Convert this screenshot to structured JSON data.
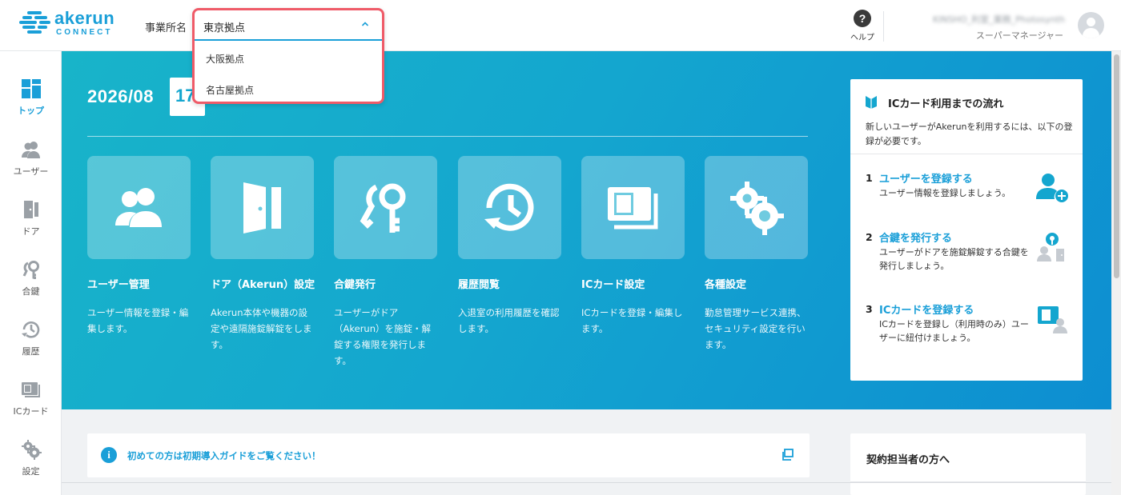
{
  "header": {
    "logo_text": "akerun",
    "logo_sub": "CONNECT",
    "office_label": "事業所名",
    "help_label": "ヘルプ",
    "user_name": "KINSHO_利室_業務_Photosynth",
    "user_role": "スーパーマネージャー"
  },
  "office_dropdown": {
    "selected": "東京拠点",
    "options": [
      "大阪拠点",
      "名古屋拠点"
    ]
  },
  "sidebar": {
    "items": [
      {
        "label": "トップ",
        "icon": "dashboard-icon",
        "active": true
      },
      {
        "label": "ユーザー",
        "icon": "users-icon"
      },
      {
        "label": "ドア",
        "icon": "door-icon"
      },
      {
        "label": "合鍵",
        "icon": "key-icon"
      },
      {
        "label": "履歴",
        "icon": "history-icon"
      },
      {
        "label": "ICカード",
        "icon": "ic-card-icon"
      },
      {
        "label": "設定",
        "icon": "gear-icon"
      }
    ]
  },
  "hero": {
    "date": "2026/08",
    "day": "17",
    "features": [
      {
        "title": "ユーザー管理",
        "desc": "ユーザー情報を登録・編集します。",
        "icon": "users-icon"
      },
      {
        "title": "ドア（Akerun）設定",
        "desc": "Akerun本体や機器の設定や遠隔施錠解錠をします。",
        "icon": "door-icon"
      },
      {
        "title": "合鍵発行",
        "desc": "ユーザーがドア（Akerun）を施錠・解錠する権限を発行します。",
        "icon": "key-icon"
      },
      {
        "title": "履歴閲覧",
        "desc": "入退室の利用履歴を確認します。",
        "icon": "history-icon"
      },
      {
        "title": "ICカード設定",
        "desc": "ICカードを登録・編集します。",
        "icon": "ic-card-icon"
      },
      {
        "title": "各種設定",
        "desc": "勤怠管理サービス連携、セキュリティ設定を行います。",
        "icon": "gear-icon"
      }
    ]
  },
  "flow": {
    "title": "ICカード利用までの流れ",
    "intro": "新しいユーザーがAkerunを利用するには、以下の登録が必要です。",
    "steps": [
      {
        "num": "1",
        "title": "ユーザーを登録する",
        "desc": "ユーザー情報を登録しましょう。",
        "icon": "add-user-icon"
      },
      {
        "num": "2",
        "title": "合鍵を発行する",
        "desc": "ユーザーがドアを施錠解錠する合鍵を発行しましょう。",
        "icon": "key-user-icon"
      },
      {
        "num": "3",
        "title": "ICカードを登録する",
        "desc": "ICカードを登録し（利用時のみ）ユーザーに紐付けましょう。",
        "icon": "card-user-icon"
      }
    ]
  },
  "guide": {
    "text": "初めての方は初期導入ガイドをご覧ください！"
  },
  "contract": {
    "title": "契約担当者の方へ"
  },
  "colors": {
    "accent": "#1a9fd8",
    "highlight_border": "#ef5b68",
    "hero_start": "#18b4c9",
    "hero_end": "#0d8ed1"
  }
}
